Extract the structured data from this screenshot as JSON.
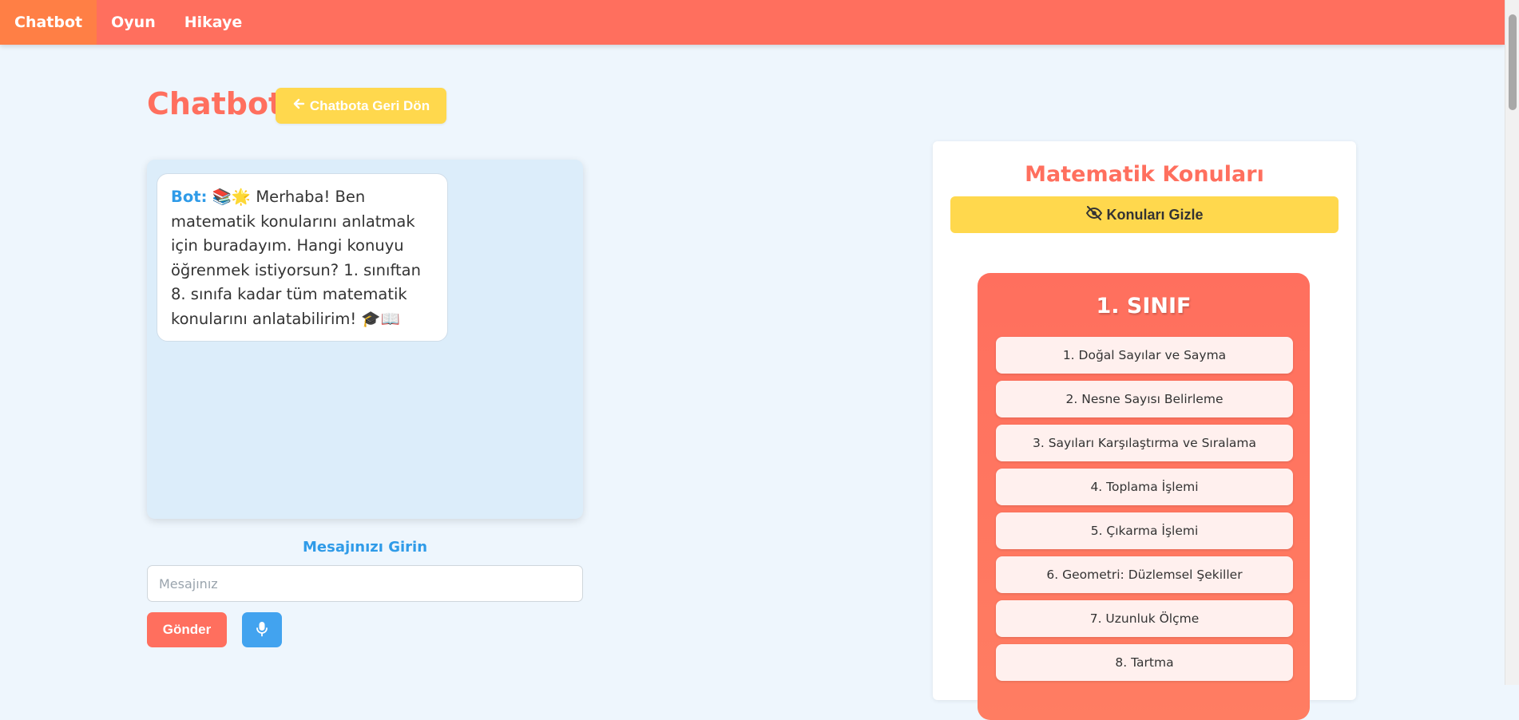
{
  "nav": {
    "items": [
      {
        "label": "Chatbot",
        "active": true
      },
      {
        "label": "Oyun",
        "active": false
      },
      {
        "label": "Hikaye",
        "active": false
      }
    ]
  },
  "header": {
    "title": "Chatbot",
    "back_button_icon": "arrow-left-icon",
    "back_button_label": "Chatbota Geri Dön"
  },
  "chat": {
    "messages": [
      {
        "sender": "Bot:",
        "text": "📚🌟 Merhaba! Ben matematik konularını anlatmak için buradayım. Hangi konuyu öğrenmek istiyorsun? 1. sınıftan 8. sınıfa kadar tüm matematik konularını anlatabilirim! 🎓📖"
      }
    ],
    "input_label": "Mesajınızı Girin",
    "input_placeholder": "Mesajınız",
    "input_value": "",
    "send_label": "Gönder",
    "mic_icon": "microphone-icon"
  },
  "topics": {
    "title": "Matematik Konuları",
    "hide_button_icon": "eye-slash-icon",
    "hide_button_label": "Konuları Gizle",
    "grade": {
      "title": "1. SINIF",
      "items": [
        "1. Doğal Sayılar ve Sayma",
        "2. Nesne Sayısı Belirleme",
        "3. Sayıları Karşılaştırma ve Sıralama",
        "4. Toplama İşlemi",
        "5. Çıkarma İşlemi",
        "6. Geometri: Düzlemsel Şekiller",
        "7. Uzunluk Ölçme",
        "8. Tartma"
      ]
    }
  },
  "colors": {
    "primary": "#ff6f5e",
    "accent_yellow": "#ffd84d",
    "accent_blue": "#2f9be8",
    "background": "#eef6fd"
  }
}
